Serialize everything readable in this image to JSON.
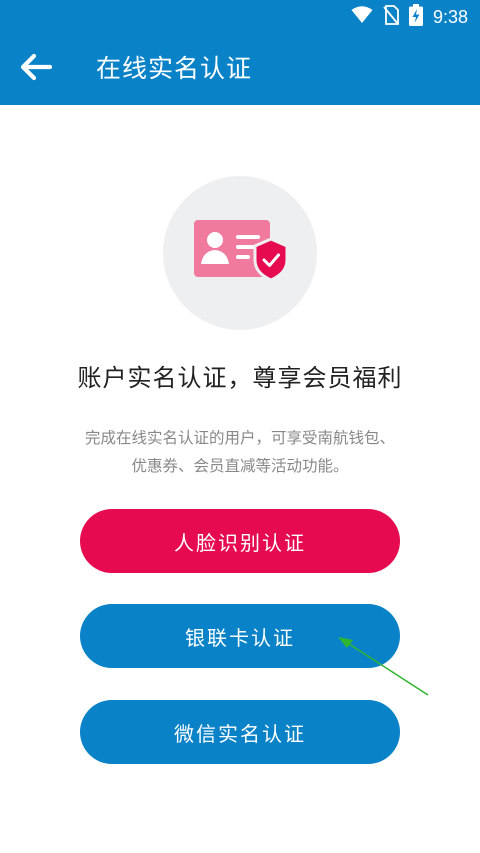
{
  "status_bar": {
    "time": "9:38",
    "icons": [
      "wifi-icon",
      "no-sim-icon",
      "battery-charging-icon"
    ]
  },
  "app_bar": {
    "back_icon": "back-arrow-icon",
    "title": "在线实名认证"
  },
  "hero": {
    "icon": "id-card-shield-icon",
    "colors": {
      "card": "#f07a9e",
      "shield": "#e60a51",
      "circle": "#eeeff1"
    }
  },
  "content": {
    "headline": "账户实名认证，尊享会员福利",
    "description_line1": "完成在线实名认证的用户，可享受南航钱包、",
    "description_line2": "优惠券、会员直减等活动功能。"
  },
  "buttons": {
    "face": {
      "label": "人脸识别认证",
      "color": "#e60a51"
    },
    "unionpay": {
      "label": "银联卡认证",
      "color": "#0a82c8"
    },
    "wechat": {
      "label": "微信实名认证",
      "color": "#0a82c8"
    }
  },
  "theme": {
    "primary": "#0a82c8",
    "accent": "#e60a51",
    "annotation": "#2fb52f"
  }
}
